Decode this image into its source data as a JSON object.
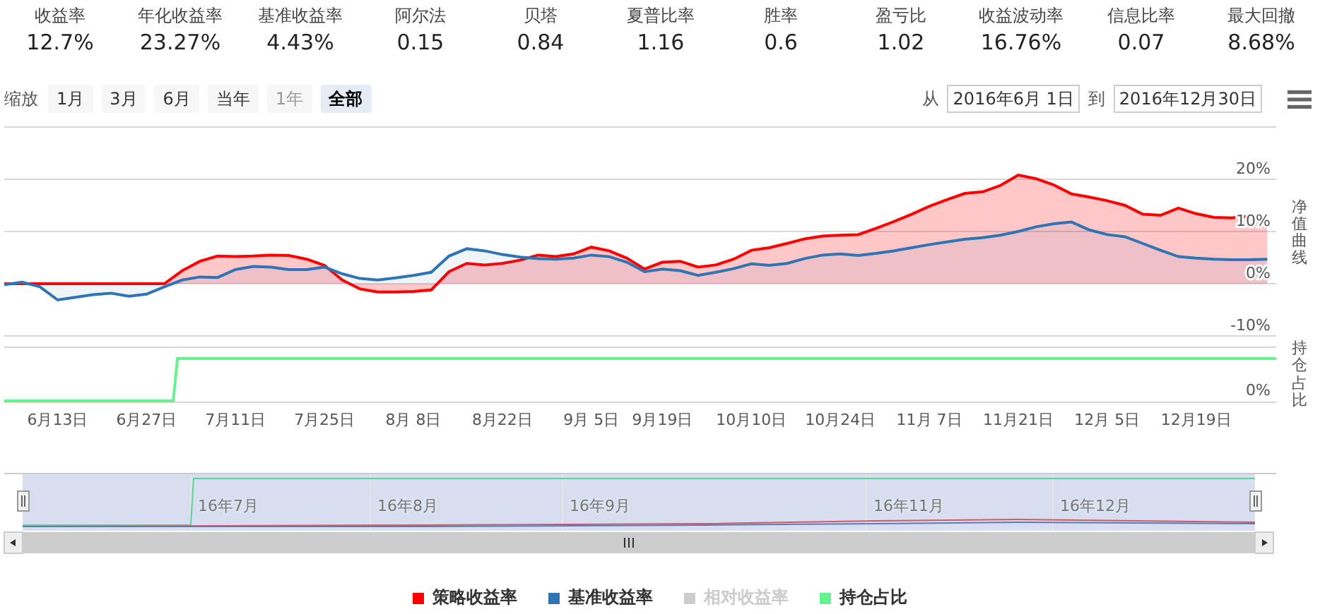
{
  "stats": [
    {
      "label": "收益率",
      "value": "12.7%"
    },
    {
      "label": "年化收益率",
      "value": "23.27%"
    },
    {
      "label": "基准收益率",
      "value": "4.43%"
    },
    {
      "label": "阿尔法",
      "value": "0.15"
    },
    {
      "label": "贝塔",
      "value": "0.84"
    },
    {
      "label": "夏普比率",
      "value": "1.16"
    },
    {
      "label": "胜率",
      "value": "0.6"
    },
    {
      "label": "盈亏比",
      "value": "1.02"
    },
    {
      "label": "收益波动率",
      "value": "16.76%"
    },
    {
      "label": "信息比率",
      "value": "0.07"
    },
    {
      "label": "最大回撤",
      "value": "8.68%"
    }
  ],
  "toolbar": {
    "zoom_label": "缩放",
    "ranges": [
      {
        "label": "1月",
        "selected": false,
        "disabled": false
      },
      {
        "label": "3月",
        "selected": false,
        "disabled": false
      },
      {
        "label": "6月",
        "selected": false,
        "disabled": false
      },
      {
        "label": "当年",
        "selected": false,
        "disabled": false
      },
      {
        "label": "1年",
        "selected": false,
        "disabled": true
      },
      {
        "label": "全部",
        "selected": true,
        "disabled": false
      }
    ],
    "from_label": "从",
    "from_date": "2016年6月 1日",
    "to_label": "到",
    "to_date": "2016年12月30日"
  },
  "chart": {
    "main_title": "净值曲线",
    "holdings_title": "持仓占比",
    "holdings_tick": "0%",
    "chart_data": {
      "type": "area",
      "categories": [
        null,
        null,
        null,
        "6月13日",
        null,
        null,
        null,
        null,
        "6月27日",
        null,
        null,
        null,
        null,
        "7月11日",
        null,
        null,
        null,
        null,
        "7月25日",
        null,
        null,
        null,
        null,
        "8月 8日",
        null,
        null,
        null,
        null,
        "8月22日",
        null,
        null,
        null,
        null,
        "9月 5日",
        null,
        null,
        null,
        "9月19日",
        null,
        null,
        null,
        null,
        "10月10日",
        null,
        null,
        null,
        null,
        "10月24日",
        null,
        null,
        null,
        null,
        "11月 7日",
        null,
        null,
        null,
        null,
        "11月21日",
        null,
        null,
        null,
        null,
        "12月 5日",
        null,
        null,
        null,
        null,
        "12月19日",
        null,
        null,
        null,
        null
      ],
      "series": [
        {
          "name": "策略收益率",
          "color": "#ff0000",
          "values": [
            0,
            0,
            0,
            0,
            0,
            0,
            0,
            0,
            0,
            0,
            2.5,
            4.3,
            5.3,
            5.2,
            5.3,
            5.5,
            5.4,
            4.7,
            3.5,
            0.7,
            -1.0,
            -1.6,
            -1.6,
            -1.5,
            -1.2,
            2.3,
            3.9,
            3.6,
            3.9,
            4.5,
            5.5,
            5.2,
            5.7,
            7,
            6.3,
            4.9,
            2.8,
            4.1,
            4.3,
            3.2,
            3.6,
            4.7,
            6.4,
            6.9,
            7.7,
            8.6,
            9.1,
            9.3,
            9.4,
            10.6,
            11.9,
            13.3,
            14.8,
            16.1,
            17.3,
            17.6,
            18.8,
            20.8,
            20.1,
            18.9,
            17.2,
            16.6,
            15.9,
            15,
            13.3,
            13.1,
            14.5,
            13.4,
            12.7,
            12.6,
            12.9,
            13.0
          ]
        },
        {
          "name": "基准收益率",
          "color": "#2f74b5",
          "values": [
            -0.2,
            0.3,
            -0.6,
            -3.1,
            -2.6,
            -2.1,
            -1.8,
            -2.4,
            -2.0,
            -0.6,
            0.7,
            1.3,
            1.2,
            2.7,
            3.3,
            3.2,
            2.7,
            2.7,
            3.2,
            1.9,
            1.0,
            0.7,
            1.1,
            1.6,
            2.2,
            5.3,
            6.7,
            6.3,
            5.6,
            5.1,
            4.8,
            4.7,
            4.9,
            5.5,
            5.2,
            4.1,
            2.3,
            2.8,
            2.5,
            1.6,
            2.2,
            2.9,
            3.8,
            3.5,
            3.9,
            4.8,
            5.5,
            5.7,
            5.4,
            5.8,
            6.3,
            6.9,
            7.5,
            8.0,
            8.5,
            8.8,
            9.3,
            10,
            10.9,
            11.5,
            11.8,
            10.3,
            9.4,
            9,
            7.7,
            6.4,
            5.2,
            4.9,
            4.7,
            4.6,
            4.6,
            4.7
          ]
        }
      ],
      "ylim": [
        -10,
        30
      ],
      "grid": true,
      "yticks": [
        {
          "value": -10,
          "label": "-10%"
        },
        {
          "value": 0,
          "label": "0%"
        },
        {
          "value": 10,
          "label": "10%"
        },
        {
          "value": 20,
          "label": "20%"
        }
      ]
    }
  },
  "navigator": {
    "labels": [
      "16年7月",
      "16年8月",
      "16年9月",
      "16年11月",
      "16年12月"
    ]
  },
  "legend": [
    {
      "visible": true
    },
    {
      "visible": true
    },
    {
      "label": "相对收益率",
      "color": "#cccccc",
      "visible": false
    },
    {
      "label": "持仓占比",
      "color": "#66f28f",
      "visible": true
    }
  ]
}
